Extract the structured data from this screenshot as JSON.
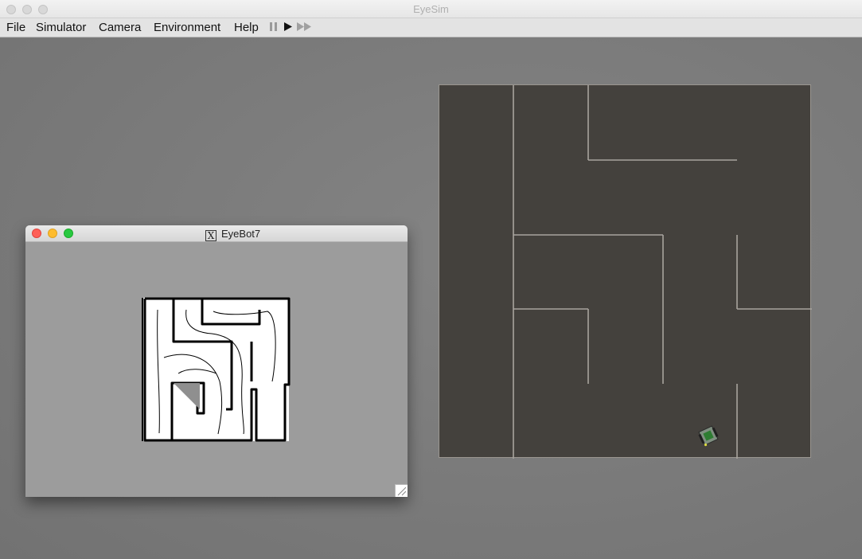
{
  "window": {
    "title": "EyeSim"
  },
  "menu": {
    "items": [
      "File",
      "Simulator",
      "Camera",
      "Environment",
      "Help"
    ],
    "controls": {
      "pause": "pause-icon",
      "play": "play-icon",
      "fast_forward": "fast-forward-icon"
    }
  },
  "subwindow": {
    "title": "EyeBot7",
    "title_icon": "x11-icon",
    "colors": {
      "background": "#9c9c9c",
      "close": "#fe5f57",
      "minimize": "#febc2e",
      "zoom": "#28c840"
    }
  },
  "arena": {
    "colors": {
      "floor": "#44413d",
      "wall": "#a8a49e"
    },
    "robot_icon": "robot-icon"
  }
}
